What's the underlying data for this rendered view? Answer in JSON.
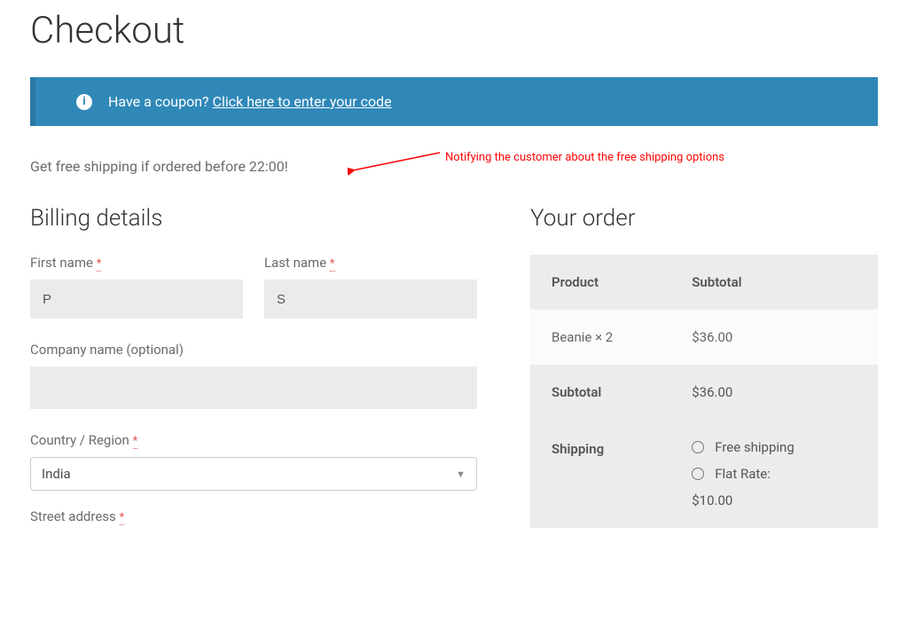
{
  "page_title": "Checkout",
  "notice": {
    "prefix": "Have a coupon? ",
    "link": "Click here to enter your code"
  },
  "promo": "Get free shipping if ordered before 22:00!",
  "annotation": "Notifying the customer about the free shipping options",
  "billing": {
    "title": "Billing details",
    "first_name_label": "First name",
    "first_name_value": "P",
    "last_name_label": "Last name",
    "last_name_value": "S",
    "company_label": "Company name (optional)",
    "company_value": "",
    "country_label": "Country / Region",
    "country_value": "India",
    "street_label": "Street address",
    "required_mark": "*"
  },
  "order": {
    "title": "Your order",
    "header_product": "Product",
    "header_subtotal": "Subtotal",
    "item_name": "Beanie  × 2",
    "item_price": "$36.00",
    "subtotal_label": "Subtotal",
    "subtotal_value": "$36.00",
    "shipping_label": "Shipping",
    "ship_free": "Free shipping",
    "ship_flat": "Flat Rate:",
    "ship_flat_price": "$10.00"
  }
}
